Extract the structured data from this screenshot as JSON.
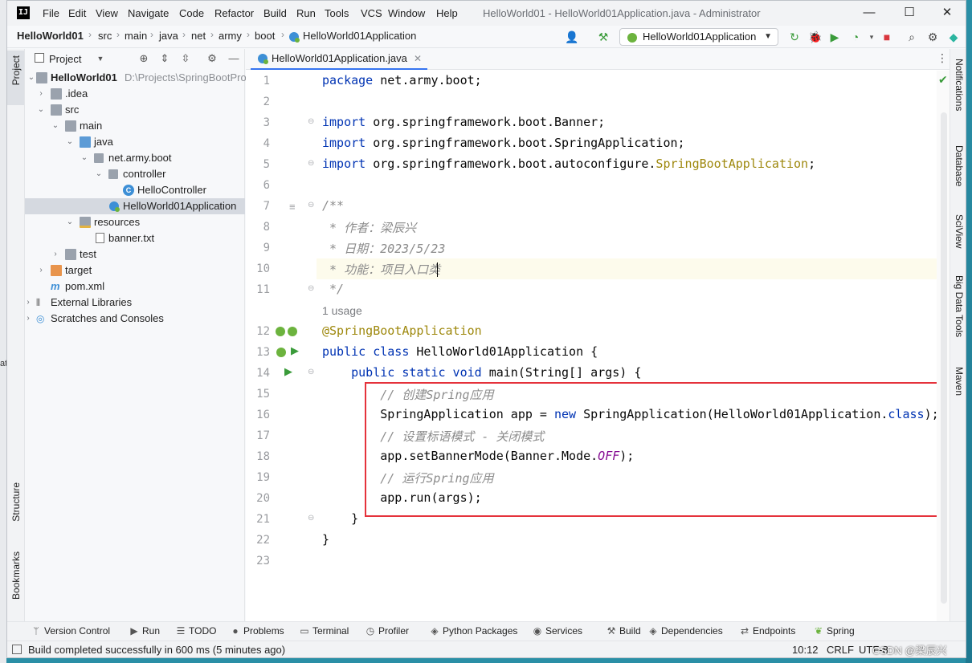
{
  "window": {
    "title": "HelloWorld01 - HelloWorld01Application.java - Administrator",
    "minimize": "—",
    "maximize": "☐",
    "close": "✕"
  },
  "menu": [
    "File",
    "Edit",
    "View",
    "Navigate",
    "Code",
    "Refactor",
    "Build",
    "Run",
    "Tools",
    "VCS",
    "Window",
    "Help"
  ],
  "breadcrumb": [
    "HelloWorld01",
    "src",
    "main",
    "java",
    "net",
    "army",
    "boot",
    "HelloWorld01Application"
  ],
  "run_config": "HelloWorld01Application",
  "left_strip": {
    "project": "Project",
    "structure": "Structure",
    "bookmarks": "Bookmarks"
  },
  "project_panel": {
    "title": "Project",
    "tree": [
      {
        "label": "HelloWorld01",
        "path": "D:\\Projects\\SpringBootPro",
        "bold": true
      },
      {
        "label": ".idea"
      },
      {
        "label": "src"
      },
      {
        "label": "main"
      },
      {
        "label": "java"
      },
      {
        "label": "net.army.boot"
      },
      {
        "label": "controller"
      },
      {
        "label": "HelloController"
      },
      {
        "label": "HelloWorld01Application"
      },
      {
        "label": "resources"
      },
      {
        "label": "banner.txt"
      },
      {
        "label": "test"
      },
      {
        "label": "target"
      },
      {
        "label": "pom.xml"
      },
      {
        "label": "External Libraries"
      },
      {
        "label": "Scratches and Consoles"
      }
    ]
  },
  "editor": {
    "tab": "HelloWorld01Application.java",
    "usage_hint": "1 usage",
    "lines": [
      "package net.army.boot;",
      "",
      "import org.springframework.boot.Banner;",
      "import org.springframework.boot.SpringApplication;",
      "import org.springframework.boot.autoconfigure.SpringBootApplication;",
      "",
      "/**",
      " * 作者：梁辰兴",
      " * 日期：2023/5/23",
      " * 功能：项目入口类",
      " */",
      "@SpringBootApplication",
      "public class HelloWorld01Application {",
      "    public static void main(String[] args) {",
      "        // 创建Spring应用",
      "        SpringApplication app = new SpringApplication(HelloWorld01Application.class);",
      "        // 设置标语模式 - 关闭模式",
      "        app.setBannerMode(Banner.Mode.OFF);",
      "        // 运行Spring应用",
      "        app.run(args);",
      "    }",
      "}",
      ""
    ]
  },
  "right_strip": [
    "Notifications",
    "Database",
    "SciView",
    "Big Data Tools",
    "Maven"
  ],
  "bottom_tools": [
    "Version Control",
    "Run",
    "TODO",
    "Problems",
    "Terminal",
    "Profiler",
    "Python Packages",
    "Services",
    "Build",
    "Dependencies",
    "Endpoints",
    "Spring"
  ],
  "status": {
    "message": "Build completed successfully in 600 ms (5 minutes ago)",
    "position": "10:12",
    "line_sep": "CRLF",
    "encoding": "UTF-8"
  },
  "watermark": "CSDN @梁辰兴",
  "background_fragment": "at"
}
